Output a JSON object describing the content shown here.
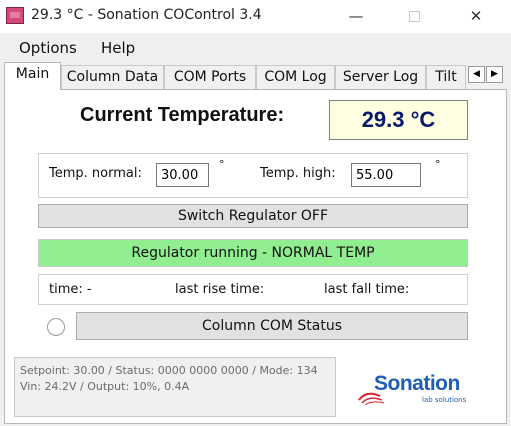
{
  "window": {
    "title": "29.3 °C - Sonation COControl 3.4",
    "minimize": "—",
    "close": "✕"
  },
  "menu": {
    "options": "Options",
    "help": "Help"
  },
  "tabs": [
    {
      "label": "Main",
      "active": true
    },
    {
      "label": "Column Data",
      "active": false
    },
    {
      "label": "COM Ports",
      "active": false
    },
    {
      "label": "COM Log",
      "active": false
    },
    {
      "label": "Server Log",
      "active": false
    },
    {
      "label": "Tilt",
      "active": false
    }
  ],
  "tab_scroll": {
    "left": "◀",
    "right": "▶"
  },
  "main": {
    "current_label": "Current Temperature:",
    "current_value": "29.3 °C",
    "temp_normal_label": "Temp. normal:",
    "temp_normal_value": "30.00",
    "temp_normal_unit": "°",
    "temp_high_label": "Temp. high:",
    "temp_high_value": "55.00",
    "temp_high_unit": "°",
    "switch_button": "Switch Regulator OFF",
    "status_text": "Regulator running - NORMAL TEMP",
    "status_color": "#90ee90",
    "time_label": "time: -",
    "last_rise_label": "last rise time:",
    "last_fall_label": "last fall time:",
    "column_com_button": "Column COM Status",
    "status_line1": "Setpoint: 30.00 / Status: 0000 0000 0000 / Mode: 134",
    "status_line2": "Vin: 24.2V / Output: 10%, 0.4A"
  },
  "logo": {
    "name": "Sonation",
    "tagline": "lab solutions"
  },
  "colors": {
    "accent": "#1f5fb3",
    "temp_text": "#0a1a6b",
    "temp_bg": "#ffffe1"
  }
}
